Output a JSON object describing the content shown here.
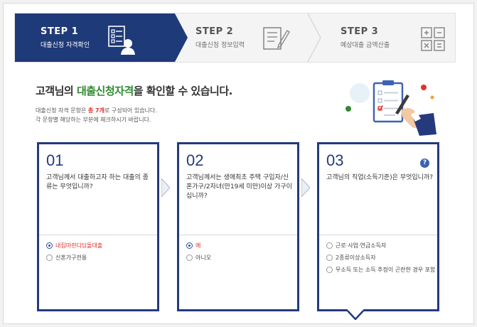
{
  "steps": [
    {
      "number": "STEP 1",
      "label": "대출신청 자격확인"
    },
    {
      "number": "STEP 2",
      "label": "대출신청 정보입력"
    },
    {
      "number": "STEP 3",
      "label": "예상대출 금액산출"
    }
  ],
  "headline": {
    "part1": "고객님의 ",
    "highlight": "대출신청자격",
    "part2": "을 확인할 수 있습니다."
  },
  "description": {
    "line1_pre": "대출신청 자격 문항은 ",
    "line1_emph": "총 7개",
    "line1_post": "로 구성되어 있습니다.",
    "line2": "각 문항별 해당하는 부분에 체크하시기 바랍니다."
  },
  "cards": [
    {
      "number": "01",
      "question": "고객님께서 대출하고자 하는 대출의 종류는 무엇입니까?",
      "options": [
        "내집마련디딤돌대출",
        "신혼가구전용"
      ]
    },
    {
      "number": "02",
      "question": "고객님께서는 생애최초 주택 구입자/신혼가구/2자녀(만19세 미만)이상 가구이십니까?",
      "options": [
        "예",
        "아니오"
      ]
    },
    {
      "number": "03",
      "question": "고객님의 직업(소득기준)은 무엇입니까?",
      "help": "?",
      "options": [
        "근로·사업·연금소득자",
        "2종류이상소득자",
        "무소득 또는 소득 추정이 곤란한 경우 포함"
      ]
    }
  ],
  "colors": {
    "navy": "#1f3a78",
    "green": "#2f8a2f",
    "red": "#e0322c"
  }
}
